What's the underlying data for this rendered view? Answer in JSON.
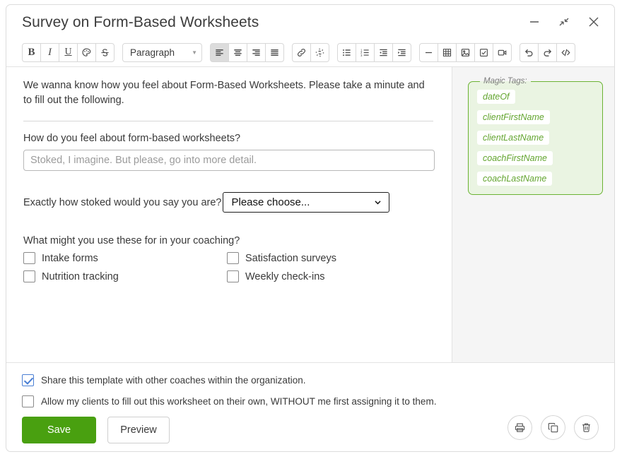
{
  "window": {
    "title": "Survey on Form-Based Worksheets",
    "controls": [
      {
        "name": "minimize-button",
        "glyph": "minimize"
      },
      {
        "name": "restore-button",
        "glyph": "collapse"
      },
      {
        "name": "close-button",
        "glyph": "close"
      }
    ]
  },
  "toolbar": {
    "paragraph_style": "Paragraph",
    "groups": [
      {
        "buttons": [
          {
            "name": "bold-icon",
            "label": "B",
            "kind": "text-b",
            "active": false
          },
          {
            "name": "italic-icon",
            "label": "I",
            "kind": "text-i",
            "active": false
          },
          {
            "name": "underline-icon",
            "label": "U",
            "kind": "text-u",
            "active": false
          },
          {
            "name": "text-color-icon",
            "label": "",
            "kind": "palette",
            "active": false
          },
          {
            "name": "strikethrough-icon",
            "label": "S",
            "kind": "strike",
            "active": false
          }
        ]
      },
      {
        "buttons": [
          {
            "name": "align-left-icon",
            "label": "",
            "kind": "align-left",
            "active": true
          },
          {
            "name": "align-center-icon",
            "label": "",
            "kind": "align-center",
            "active": false
          },
          {
            "name": "align-right-icon",
            "label": "",
            "kind": "align-right",
            "active": false
          },
          {
            "name": "align-justify-icon",
            "label": "",
            "kind": "align-justify",
            "active": false
          }
        ]
      },
      {
        "buttons": [
          {
            "name": "insert-link-icon",
            "label": "",
            "kind": "link",
            "active": false
          },
          {
            "name": "remove-link-icon",
            "label": "",
            "kind": "unlink",
            "active": false
          }
        ]
      },
      {
        "buttons": [
          {
            "name": "bullet-list-icon",
            "label": "",
            "kind": "ul",
            "active": false
          },
          {
            "name": "numbered-list-icon",
            "label": "",
            "kind": "ol",
            "active": false
          },
          {
            "name": "outdent-icon",
            "label": "",
            "kind": "outdent",
            "active": false
          },
          {
            "name": "indent-icon",
            "label": "",
            "kind": "indent",
            "active": false
          }
        ]
      },
      {
        "buttons": [
          {
            "name": "horizontal-rule-icon",
            "label": "",
            "kind": "hr",
            "active": false
          },
          {
            "name": "insert-table-icon",
            "label": "",
            "kind": "table",
            "active": false
          },
          {
            "name": "insert-image-icon",
            "label": "",
            "kind": "image",
            "active": false
          },
          {
            "name": "insert-checkbox-icon",
            "label": "",
            "kind": "checkbox",
            "active": false
          },
          {
            "name": "insert-video-icon",
            "label": "",
            "kind": "video",
            "active": false
          }
        ]
      },
      {
        "buttons": [
          {
            "name": "undo-icon",
            "label": "",
            "kind": "undo",
            "active": false
          },
          {
            "name": "redo-icon",
            "label": "",
            "kind": "redo",
            "active": false
          },
          {
            "name": "source-code-icon",
            "label": "",
            "kind": "code",
            "active": false
          }
        ]
      }
    ]
  },
  "editor": {
    "intro": "We wanna know how you feel about Form-Based Worksheets. Please take a minute and to fill out the following.",
    "question_text": "How do you feel about form-based worksheets?",
    "text_answer_placeholder": "Stoked, I imagine. But please, go into more detail.",
    "text_answer_value": "",
    "select_question": "Exactly how stoked would you say you are?",
    "select_value": "Please choose...",
    "checkbox_question": "What might you use these for in your coaching?",
    "checkbox_options": [
      {
        "label": "Intake forms",
        "checked": false
      },
      {
        "label": "Satisfaction surveys",
        "checked": false
      },
      {
        "label": "Nutrition tracking",
        "checked": false
      },
      {
        "label": "Weekly check-ins",
        "checked": false
      }
    ]
  },
  "sidebar": {
    "legend": "Magic Tags:",
    "accent_color": "#6bb334",
    "background_color": "#eaf4e2",
    "tag_text_color": "#63a52f",
    "tags": [
      {
        "label": "dateOf",
        "row_break": false
      },
      {
        "label": "clientFirstName",
        "row_break": true
      },
      {
        "label": "clientLastName",
        "row_break": true
      },
      {
        "label": "coachFirstName",
        "row_break": true
      },
      {
        "label": "coachLastName",
        "row_break": true
      }
    ]
  },
  "footer": {
    "options": [
      {
        "label": "Share this template with other coaches within the organization.",
        "checked": true
      },
      {
        "label": "Allow my clients to fill out this worksheet on their own, WITHOUT me first assigning it to them.",
        "checked": false
      }
    ],
    "save_label": "Save",
    "preview_label": "Preview",
    "save_color": "#49a010",
    "actions": [
      {
        "name": "print-button",
        "glyph": "print"
      },
      {
        "name": "duplicate-button",
        "glyph": "copy"
      },
      {
        "name": "delete-button",
        "glyph": "trash"
      }
    ]
  }
}
